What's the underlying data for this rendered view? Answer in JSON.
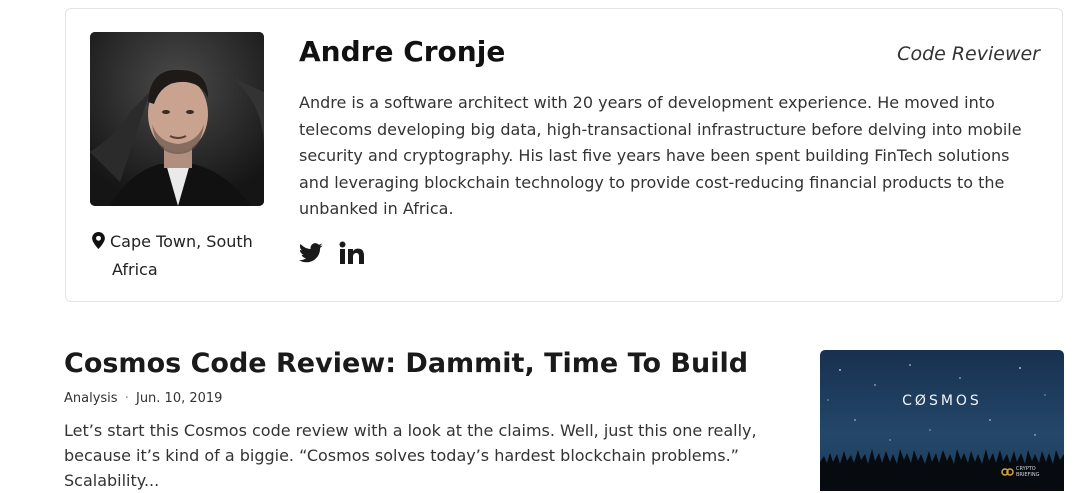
{
  "author": {
    "name": "Andre Cronje",
    "role": "Code Reviewer",
    "location_line1": "Cape Town, South",
    "location_line2": "Africa",
    "bio": "Andre is a software architect with 20 years of development experience. He moved into telecoms developing big data, high-transactional infrastructure before delving into mobile security and cryptography. His last five years have been spent building FinTech solutions and leveraging blockchain technology to provide cost-reducing financial products to the unbanked in Africa.",
    "socials": [
      {
        "icon": "twitter-icon"
      },
      {
        "icon": "linkedin-icon"
      }
    ]
  },
  "article": {
    "title": "Cosmos Code Review: Dammit, Time To Build",
    "category": "Analysis",
    "separator": "·",
    "date": "Jun. 10, 2019",
    "excerpt": "Let’s start this Cosmos code review with a look at the claims. Well, just this one really, because it’s kind of a biggie. “Cosmos solves today’s hardest blockchain problems.” Scalability...",
    "thumbnail_text": "CØSMOS",
    "thumbnail_badge_line1": "CRYPTO",
    "thumbnail_badge_line2": "BRIEFING"
  },
  "colors": {
    "card_border": "#e4e4e4",
    "text_dark": "#111111",
    "thumbnail_bg": "#1b2d4a"
  }
}
